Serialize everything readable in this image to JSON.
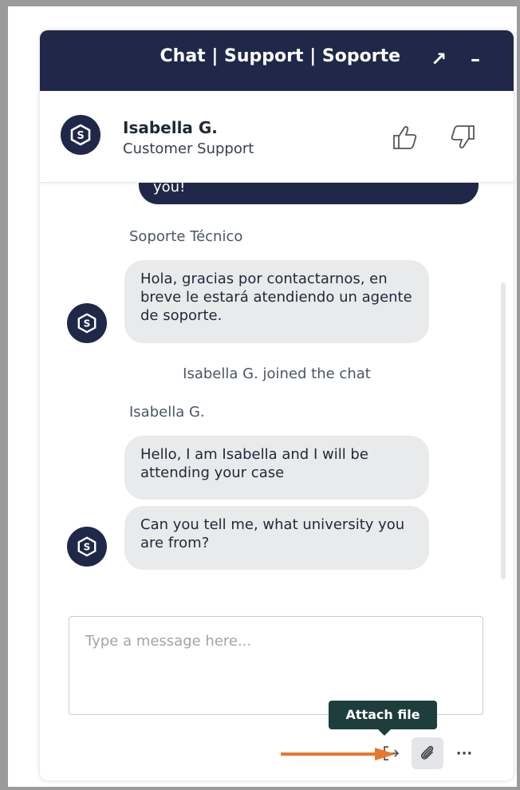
{
  "header": {
    "title": "Chat | Support | Soporte",
    "popout_icon": "arrow-up-right-icon",
    "minimize_icon": "minus-icon",
    "popout_glyph": "↗",
    "minimize_glyph": "–"
  },
  "agent": {
    "name": "Isabella G.",
    "role": "Customer Support"
  },
  "messages": {
    "outgoing_partial": "you!",
    "sender_bot": "Soporte Técnico",
    "bot_text": "Hola, gracias por contactarnos, en breve le estará atendiendo un agente de soporte.",
    "system_joined": "Isabella G. joined the chat",
    "sender_agent": "Isabella G.",
    "agent_msg_1": "Hello, I am Isabella and I will be attending your case",
    "agent_msg_2": "Can you tell me, what university you are from?"
  },
  "composer": {
    "placeholder": "Type a message here...",
    "value": ""
  },
  "toolbar": {
    "tooltip": "Attach file",
    "more_glyph": "···"
  },
  "colors": {
    "brand_navy": "#1f2848",
    "bubble_gray": "#e9eaec",
    "tooltip_bg": "#1e3d3d",
    "annotation_arrow": "#e8772e"
  }
}
